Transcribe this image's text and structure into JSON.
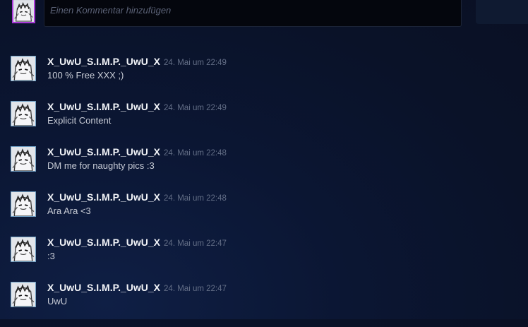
{
  "composer": {
    "placeholder": "Einen Kommentar hinzufügen"
  },
  "comments": [
    {
      "author": "X_UwU_S.I.M.P._UwU_X",
      "timestamp": "24. Mai um 22:49",
      "text": "100 % Free XXX ;)"
    },
    {
      "author": "X_UwU_S.I.M.P._UwU_X",
      "timestamp": "24. Mai um 22:49",
      "text": "Explicit Content"
    },
    {
      "author": "X_UwU_S.I.M.P._UwU_X",
      "timestamp": "24. Mai um 22:48",
      "text": "DM me for naughty pics :3"
    },
    {
      "author": "X_UwU_S.I.M.P._UwU_X",
      "timestamp": "24. Mai um 22:48",
      "text": "Ara Ara <3"
    },
    {
      "author": "X_UwU_S.I.M.P._UwU_X",
      "timestamp": "24. Mai um 22:47",
      "text": ":3"
    },
    {
      "author": "X_UwU_S.I.M.P._UwU_X",
      "timestamp": "24. Mai um 22:47",
      "text": "UwU"
    }
  ]
}
